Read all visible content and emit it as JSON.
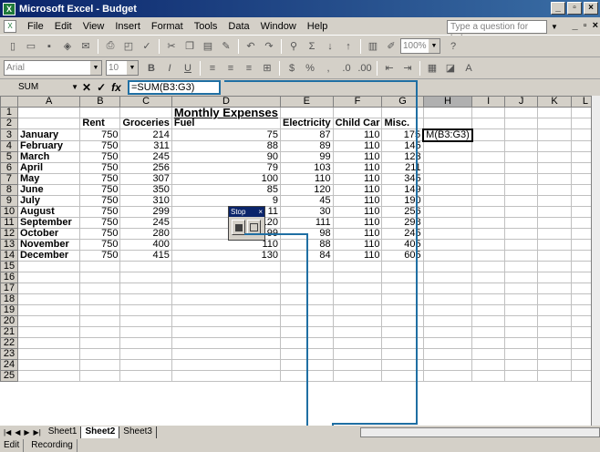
{
  "window": {
    "title": "Microsoft Excel - Budget"
  },
  "menubar": {
    "items": [
      "File",
      "Edit",
      "View",
      "Insert",
      "Format",
      "Tools",
      "Data",
      "Window",
      "Help"
    ],
    "ask_placeholder": "Type a question for help"
  },
  "toolbar": {
    "zoom": "100%",
    "font": "Arial",
    "size": "10"
  },
  "formula_bar": {
    "name_box": "SUM",
    "formula": "=SUM(B3:G3)"
  },
  "columns": [
    "A",
    "B",
    "C",
    "D",
    "E",
    "F",
    "G",
    "H",
    "I",
    "J",
    "K",
    "L"
  ],
  "sheet": {
    "title": "Monthly Expenses",
    "headers": [
      "",
      "Rent",
      "Groceries",
      "Fuel",
      "Electricity",
      "Child Car",
      "Misc."
    ],
    "rows": [
      [
        "January",
        "750",
        "214",
        "75",
        "87",
        "110",
        "175"
      ],
      [
        "February",
        "750",
        "311",
        "88",
        "89",
        "110",
        "145"
      ],
      [
        "March",
        "750",
        "245",
        "90",
        "99",
        "110",
        "123"
      ],
      [
        "April",
        "750",
        "256",
        "79",
        "103",
        "110",
        "211"
      ],
      [
        "May",
        "750",
        "307",
        "100",
        "110",
        "110",
        "345"
      ],
      [
        "June",
        "750",
        "350",
        "85",
        "120",
        "110",
        "149"
      ],
      [
        "July",
        "750",
        "310",
        "9",
        "45",
        "110",
        "190"
      ],
      [
        "August",
        "750",
        "299",
        "11",
        "30",
        "110",
        "256"
      ],
      [
        "September",
        "750",
        "245",
        "120",
        "111",
        "110",
        "298"
      ],
      [
        "October",
        "750",
        "280",
        "99",
        "98",
        "110",
        "245"
      ],
      [
        "November",
        "750",
        "400",
        "110",
        "88",
        "110",
        "405"
      ],
      [
        "December",
        "750",
        "415",
        "130",
        "84",
        "110",
        "605"
      ]
    ],
    "h3_value": "M(B3:G3)"
  },
  "stop_toolbar": {
    "title": "Stop"
  },
  "sheet_tabs": [
    "Sheet1",
    "Sheet2",
    "Sheet3"
  ],
  "status": {
    "mode": "Edit",
    "recording": "Recording"
  }
}
